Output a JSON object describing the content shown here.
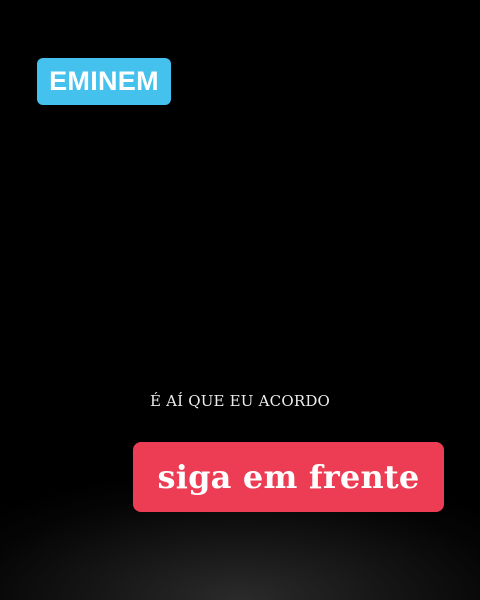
{
  "artist": {
    "label": "EMINEM",
    "badge_color": "#45c1ee"
  },
  "lyrics": {
    "caption": "É AÍ QUE EU ACORDO"
  },
  "action": {
    "label": "siga em frente",
    "color": "#ec3d54"
  },
  "colors": {
    "background": "#000000",
    "text": "#ffffff"
  }
}
